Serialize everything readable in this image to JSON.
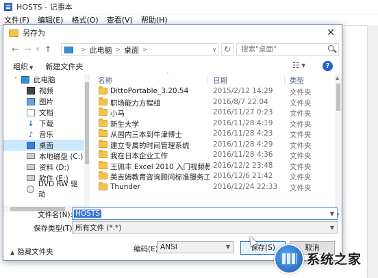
{
  "notepad": {
    "title": "HOSTS - 记事本",
    "menus": [
      "文件(F)",
      "编辑(E)",
      "格式(O)",
      "查看(V)",
      "帮助(H)"
    ]
  },
  "dialog": {
    "title": "另存为",
    "close_glyph": "✕",
    "nav": {
      "back_glyph": "←",
      "forward_glyph": "→",
      "dropdown_glyph": "∨",
      "up_glyph": "↑",
      "breadcrumb": [
        "此电脑",
        "桌面"
      ],
      "refresh_glyph": "↻",
      "search_placeholder": "搜索\"桌面\""
    },
    "toolbar": {
      "organize": "组织",
      "new_folder": "新建文件夹",
      "view_glyph": "☷ ▾",
      "help_glyph": "?"
    },
    "nav_pane": [
      {
        "label": "此电脑",
        "icon": "pc-icon"
      },
      {
        "label": "视频",
        "icon": "video-icon"
      },
      {
        "label": "图片",
        "icon": "pictures-icon"
      },
      {
        "label": "文档",
        "icon": "documents-icon"
      },
      {
        "label": "下载",
        "icon": "download-icon"
      },
      {
        "label": "音乐",
        "icon": "music-icon"
      },
      {
        "label": "桌面",
        "icon": "desktop-icon",
        "selected": true
      },
      {
        "label": "本地磁盘 (C:)",
        "icon": "drive-icon"
      },
      {
        "label": "资料 (D:)",
        "icon": "drive-icon"
      },
      {
        "label": "软件 (E:)",
        "icon": "drive-icon"
      },
      {
        "label": "DVD RW 驱动",
        "icon": "dvd-icon"
      }
    ],
    "columns": {
      "name": "名称",
      "date": "日期",
      "type": "类型"
    },
    "files": [
      {
        "name": "DittoPortable_3.20.54",
        "date": "2015/2/12 14:29",
        "type": "文件夹"
      },
      {
        "name": "职场能力方程组",
        "date": "2016/8/7 22:04",
        "type": "文件夹"
      },
      {
        "name": "小马",
        "date": "2016/11/27 0:23",
        "type": "文件夹"
      },
      {
        "name": "新生大学",
        "date": "2016/11/28 4:19",
        "type": "文件夹"
      },
      {
        "name": "从国内三本到牛津博士",
        "date": "2016/11/28 4:23",
        "type": "文件夹"
      },
      {
        "name": "建立专属的时间管理系统",
        "date": "2016/11/28 4:29",
        "type": "文件夹"
      },
      {
        "name": "我在日本企业工作",
        "date": "2016/11/28 4:36",
        "type": "文件夹"
      },
      {
        "name": "王佩丰 Excel 2010 入门视频教程1...",
        "date": "2016/12/2 23:48",
        "type": "文件夹"
      },
      {
        "name": "美吉姆教育咨询顾问标准服务工作...",
        "date": "2016/12/6 21:42",
        "type": "文件夹"
      },
      {
        "name": "Thunder",
        "date": "2016/12/24 22:33",
        "type": "文件夹"
      }
    ],
    "filename_label": "文件名(N):",
    "filename_label_key": "N",
    "filename_value": "HOSTS",
    "filetype_label": "保存类型(T):",
    "filetype_label_key": "T",
    "filetype_value": "所有文件  (*.*)",
    "hide_folders": "隐藏文件夹",
    "encoding_label": "编码(E):",
    "encoding_value": "ANSI",
    "save_button": "保存(S)",
    "cancel_button": "取消"
  },
  "watermark": {
    "text": "系统之家"
  }
}
